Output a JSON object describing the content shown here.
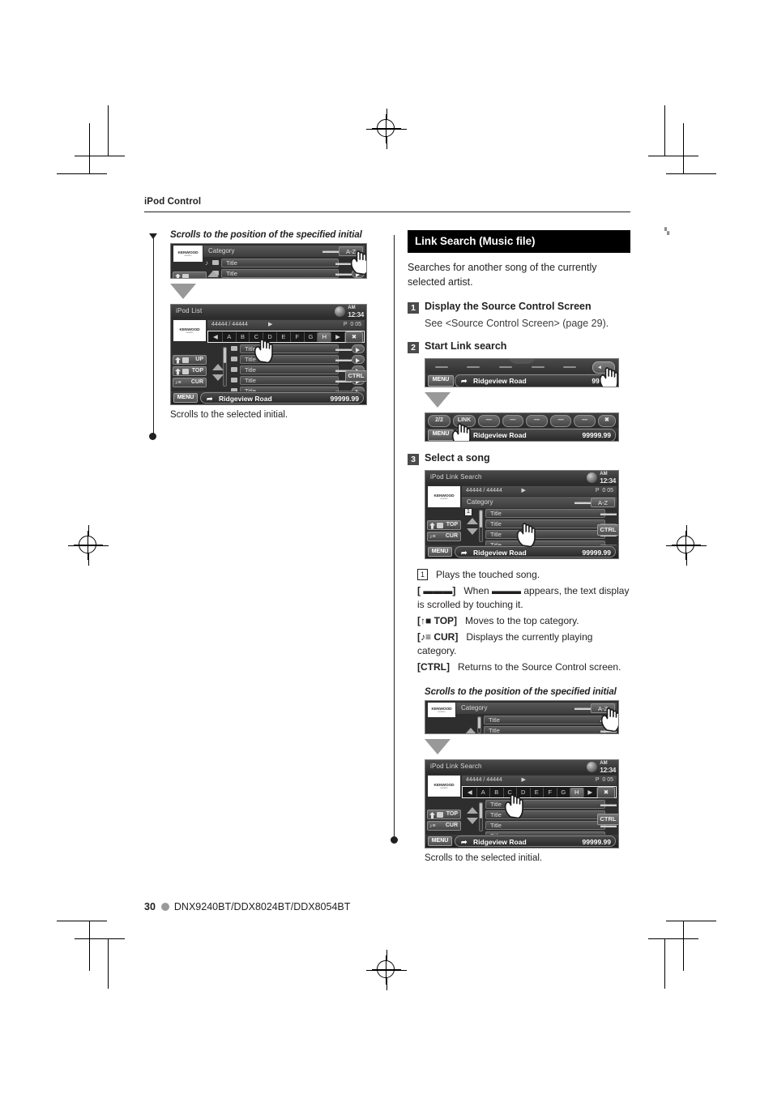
{
  "running_head": "iPod Control",
  "footer": {
    "page_number": "30",
    "models": "DNX9240BT/DDX8024BT/DDX8054BT"
  },
  "left_column": {
    "caption_top": "Scrolls to the position of the specified initial",
    "caption_bottom": "Scrolls to the selected initial.",
    "screen_partial": {
      "category_label": "Category",
      "dots": "▬▬▬",
      "az_label": "A-Z",
      "rows": [
        "Title",
        "Title"
      ]
    },
    "screen_full": {
      "title": "iPod List",
      "clock_meridiem": "AM",
      "clock_time": "12:34",
      "logo_name": "KENWOOD",
      "logo_sub": "excelon",
      "track_counter": "44444  /  44444",
      "play_symbol": "▶",
      "mode": "P",
      "elapsed": "0  05",
      "alphabet": [
        "◀",
        "A",
        "B",
        "C",
        "D",
        "E",
        "F",
        "G",
        "H",
        "▶"
      ],
      "selected_letter": "H",
      "close_label": "✖",
      "rows": [
        "Title",
        "Title",
        "Title",
        "Title",
        "Title"
      ],
      "left_buttons": [
        "UP",
        "TOP",
        "CUR"
      ],
      "ctrl_label": "CTRL",
      "menu_label": "MENU",
      "track_name": "Ridgeview Road",
      "track_time": "99999.99"
    }
  },
  "right_column": {
    "section_title": "Link Search (Music file)",
    "lead": "Searches for another song of the currently selected artist.",
    "steps": [
      {
        "num": "1",
        "title": "Display the Source Control Screen",
        "sub": "See <Source Control Screen> (page 29)."
      },
      {
        "num": "2",
        "title": "Start Link search",
        "sub": ""
      },
      {
        "num": "3",
        "title": "Select a song",
        "sub": ""
      }
    ],
    "step2_screen_a": {
      "menu_label": "MENU",
      "track_name": "Ridgeview Road",
      "track_time": "99999"
    },
    "step2_screen_b": {
      "pills": [
        "2/2",
        "LINK",
        "—",
        "—",
        "—",
        "—",
        "—"
      ],
      "close_label": "✖",
      "menu_label": "MENU",
      "track_name": "Ridgeview Road",
      "track_time": "99999.99"
    },
    "step3_screen": {
      "title": "iPod Link Search",
      "clock_meridiem": "AM",
      "clock_time": "12:34",
      "logo_name": "KENWOOD",
      "logo_sub": "excelon",
      "track_counter": "44444  /  44444",
      "play_symbol": "▶",
      "mode": "P",
      "elapsed": "0  05",
      "category_label": "Category",
      "az_label": "A-Z",
      "callout_num": "1",
      "rows": [
        "Title",
        "Title",
        "Title",
        "Title",
        "Title"
      ],
      "left_buttons": [
        "TOP",
        "CUR"
      ],
      "ctrl_label": "CTRL",
      "menu_label": "MENU",
      "track_name": "Ridgeview Road",
      "track_time": "99999.99"
    },
    "bullets": [
      {
        "key": "1",
        "key_type": "boxnum",
        "text": "Plays the touched song."
      },
      {
        "key": "[ ▬▬▬]",
        "key_type": "plain",
        "text": "When ▬▬▬ appears, the text display is scrolled by touching it."
      },
      {
        "key": "[↑■ TOP]",
        "key_type": "plain",
        "text": "Moves to the top category."
      },
      {
        "key": "[♪≡ CUR]",
        "key_type": "plain",
        "text": "Displays the currently playing category."
      },
      {
        "key": "[CTRL]",
        "key_type": "plain",
        "text": "Returns to the Source Control screen."
      }
    ],
    "caption_bottom_title": "Scrolls to the position of the specified initial",
    "caption_bottom": "Scrolls to the selected initial.",
    "screen_partial": {
      "category_label": "Category",
      "az_label": "A-Z",
      "rows": [
        "Title",
        "Title"
      ]
    },
    "screen_full": {
      "title": "iPod Link Search",
      "clock_meridiem": "AM",
      "clock_time": "12:34",
      "logo_name": "KENWOOD",
      "logo_sub": "excelon",
      "track_counter": "44444  /  44444",
      "play_symbol": "▶",
      "mode": "P",
      "elapsed": "0  05",
      "alphabet": [
        "◀",
        "A",
        "B",
        "C",
        "D",
        "E",
        "F",
        "G",
        "H",
        "▶"
      ],
      "selected_letter": "H",
      "close_label": "✖",
      "rows": [
        "Title",
        "Title",
        "Title",
        "Title",
        "Title"
      ],
      "left_buttons": [
        "TOP",
        "CUR"
      ],
      "ctrl_label": "CTRL",
      "menu_label": "MENU",
      "track_name": "Ridgeview Road",
      "track_time": "99999.99"
    }
  }
}
